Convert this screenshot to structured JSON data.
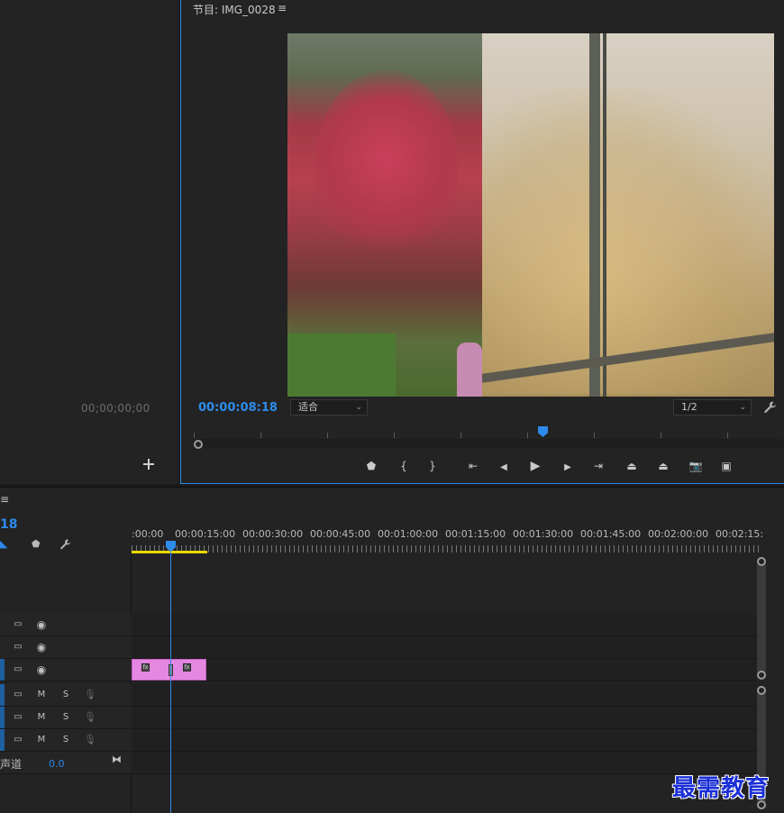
{
  "source_panel": {
    "timecode": "00;00;00;00"
  },
  "program_monitor": {
    "title": "节目: IMG_0028",
    "menu_icon": "≡",
    "timecode": "00:00:08:18",
    "fit_dropdown": "适合",
    "resolution_dropdown": "1/2",
    "playhead_position": 0.59
  },
  "transport_buttons": [
    {
      "name": "add-marker-button",
      "glyph": "⬟",
      "icon": "marker-icon"
    },
    {
      "name": "mark-in-button",
      "glyph": "{",
      "icon": "mark-in-icon"
    },
    {
      "name": "mark-out-button",
      "glyph": "}",
      "icon": "mark-out-icon"
    },
    {
      "name": "go-to-in-button",
      "glyph": "⇤",
      "icon": "go-to-in-icon"
    },
    {
      "name": "step-back-button",
      "glyph": "◀",
      "icon": "step-back-icon"
    },
    {
      "name": "play-button",
      "glyph": "▶",
      "icon": "play-icon"
    },
    {
      "name": "step-forward-button",
      "glyph": "▶",
      "icon": "step-forward-icon"
    },
    {
      "name": "go-to-out-button",
      "glyph": "⇥",
      "icon": "go-to-out-icon"
    },
    {
      "name": "lift-button",
      "glyph": "⏏",
      "icon": "lift-icon"
    },
    {
      "name": "extract-button",
      "glyph": "⏏",
      "icon": "extract-icon"
    },
    {
      "name": "export-frame-button",
      "glyph": "📷",
      "icon": "camera-icon"
    },
    {
      "name": "comparison-view-button",
      "glyph": "▣",
      "icon": "comparison-view-icon"
    }
  ],
  "timeline": {
    "menu_icon": "≡",
    "timecode": "18",
    "ruler_labels": [
      ":00:00",
      "00:00:15:00",
      "00:00:30:00",
      "00:00:45:00",
      "00:01:00:00",
      "00:01:15:00",
      "00:01:30:00",
      "00:01:45:00",
      "00:02:00:00",
      "00:02:15:"
    ],
    "video_tracks": [
      {
        "selected": false,
        "has_clip": false
      },
      {
        "selected": false,
        "has_clip": false
      },
      {
        "selected": true,
        "has_clip": true
      }
    ],
    "audio_tracks": [
      {
        "m": "M",
        "s": "S"
      },
      {
        "m": "M",
        "s": "S"
      },
      {
        "m": "M",
        "s": "S"
      }
    ],
    "master": {
      "label": "声道",
      "value": "0.0"
    },
    "clip_color": "#e487e0"
  },
  "watermark": "最需教育",
  "accent_color": "#2d8ceb"
}
